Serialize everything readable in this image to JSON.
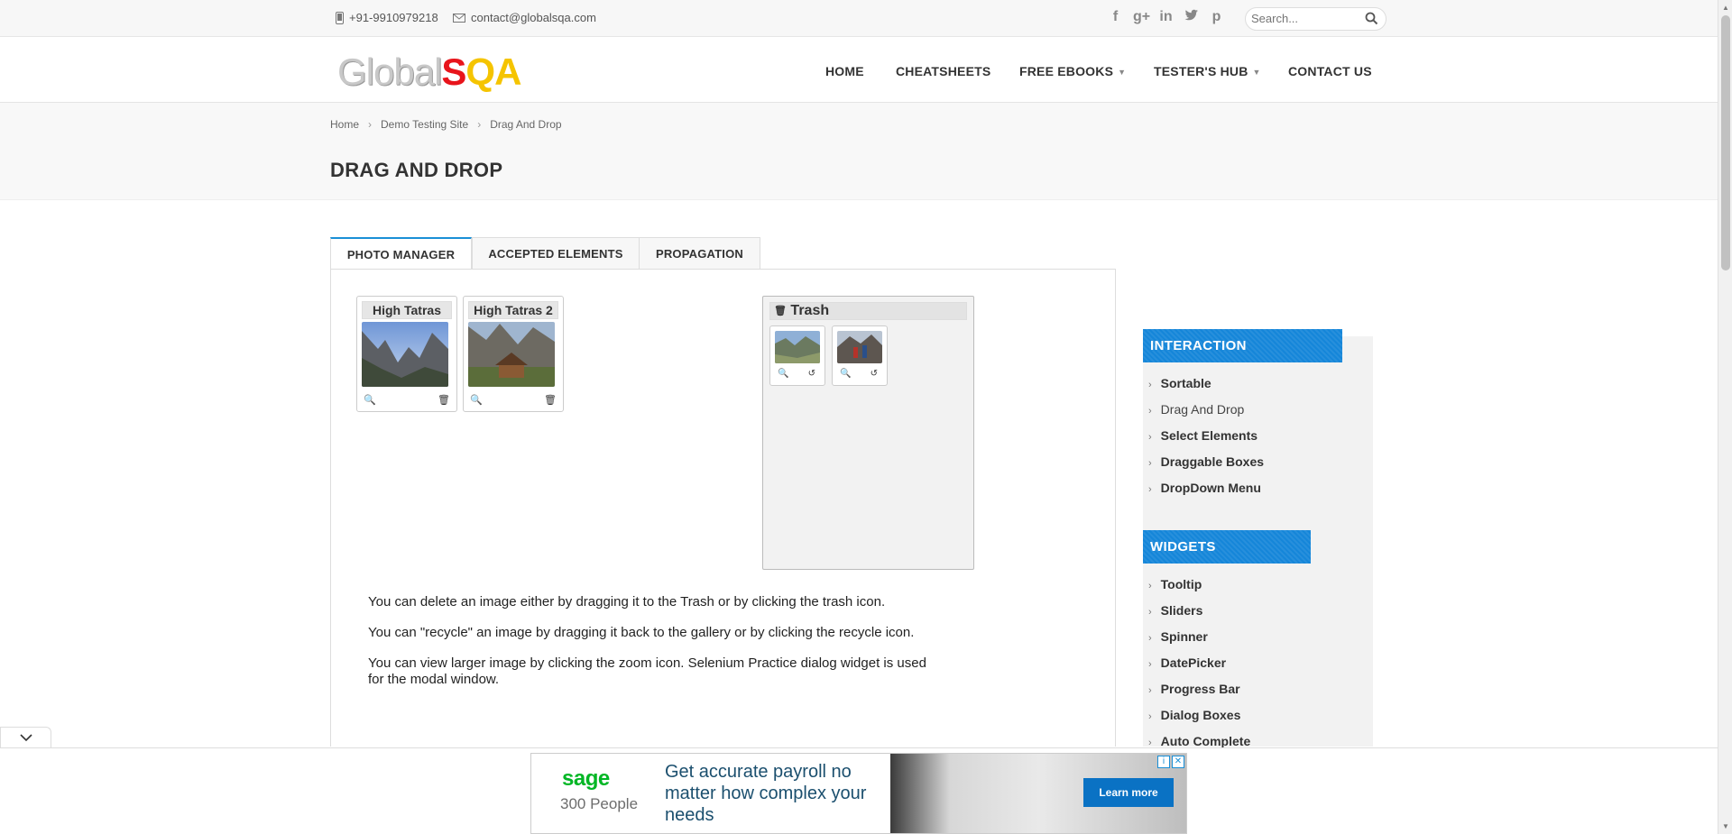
{
  "topbar": {
    "phone": "+91-9910979218",
    "email": "contact@globalsqa.com",
    "social_icons": [
      "facebook-icon",
      "google-plus-icon",
      "linkedin-icon",
      "twitter-icon",
      "pinterest-icon"
    ],
    "search_placeholder": "Search..."
  },
  "logo": {
    "part1": "Global",
    "part2": "S",
    "part3": "QA"
  },
  "nav": {
    "home": "HOME",
    "cheatsheets": "CHEATSHEETS",
    "free_ebooks": "FREE EBOOKS",
    "testers_hub": "TESTER'S HUB",
    "contact_us": "CONTACT US"
  },
  "breadcrumb": {
    "home": "Home",
    "demo": "Demo Testing Site",
    "current": "Drag And Drop",
    "separator": "›"
  },
  "page_title": "DRAG AND DROP",
  "tabs": {
    "photo_manager": "PHOTO MANAGER",
    "accepted_elements": "ACCEPTED ELEMENTS",
    "propagation": "PROPAGATION"
  },
  "gallery": {
    "photos": [
      {
        "title": "High Tatras"
      },
      {
        "title": "High Tatras 2"
      }
    ]
  },
  "trash": {
    "title": "Trash",
    "items_count": 2
  },
  "description": {
    "line1": "You can delete an image either by dragging it to the Trash or by clicking the trash icon.",
    "line2": "You can \"recycle\" an image by dragging it back to the gallery or by clicking the recycle icon.",
    "line3": "You can view larger image by clicking the zoom icon. Selenium Practice dialog widget is used for the modal window."
  },
  "sidebar": {
    "interaction_title": "INTERACTION",
    "interaction_items": [
      "Sortable",
      "Drag And Drop",
      "Select Elements",
      "Draggable Boxes",
      "DropDown Menu"
    ],
    "widgets_title": "WIDGETS",
    "widget_items": [
      "Tooltip",
      "Sliders",
      "Spinner",
      "DatePicker",
      "Progress Bar",
      "Dialog Boxes",
      "Auto Complete"
    ]
  },
  "ad": {
    "brand": "sage",
    "brand_sub": "300 People",
    "headline": "Get accurate payroll no matter how complex your needs",
    "cta": "Learn more"
  },
  "colors": {
    "accent": "#1586d9",
    "logo_red": "#e8141b",
    "logo_yellow": "#f5c400"
  }
}
